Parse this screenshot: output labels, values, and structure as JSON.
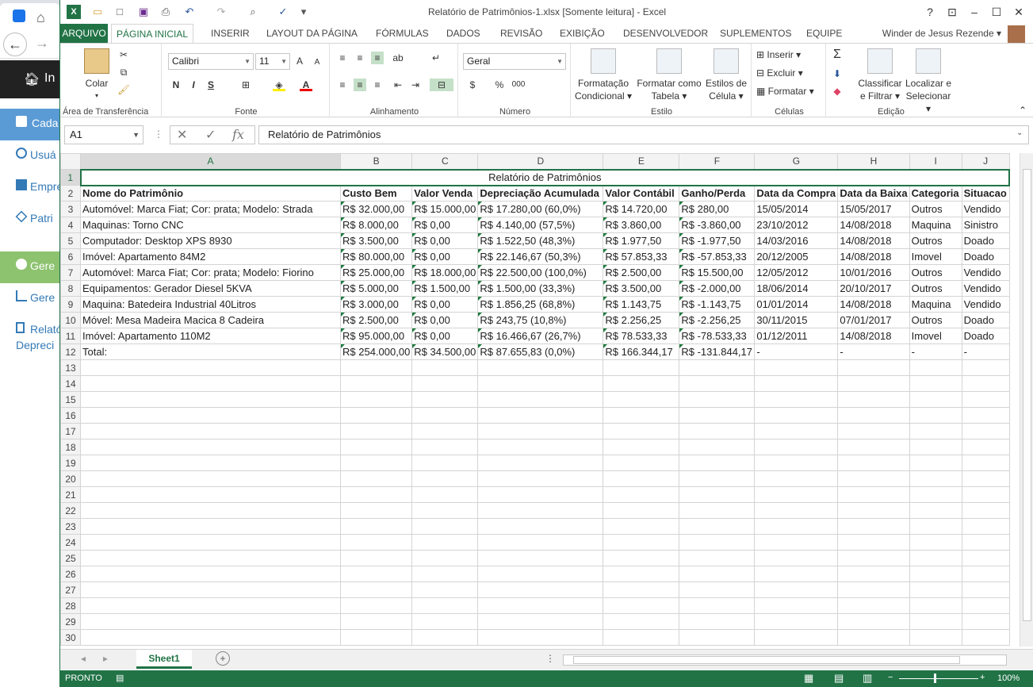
{
  "background_app": {
    "nav_brand": "In",
    "items": [
      {
        "label": "Cada"
      },
      {
        "label": "Usuá"
      },
      {
        "label": "Empre"
      },
      {
        "label": "Patri"
      },
      {
        "label": "Gere"
      },
      {
        "label": "Gere"
      },
      {
        "label": "Relató"
      },
      {
        "label": "Depreci"
      }
    ]
  },
  "window": {
    "title": "Relatório de Patrimônios-1.xlsx  [Somente leitura] - Excel",
    "help": "?",
    "user": "Winder de Jesus Rezende"
  },
  "tabs": [
    "ARQUIVO",
    "PÁGINA INICIAL",
    "INSERIR",
    "LAYOUT DA PÁGINA",
    "FÓRMULAS",
    "DADOS",
    "REVISÃO",
    "EXIBIÇÃO",
    "DESENVOLVEDOR",
    "SUPLEMENTOS",
    "EQUIPE"
  ],
  "ribbon": {
    "clipboard": {
      "paste": "Colar",
      "label": "Área de Transferência"
    },
    "font": {
      "name": "Calibri",
      "size": "11",
      "bold": "N",
      "italic": "I",
      "underline": "S",
      "grow": "A",
      "shrink": "A",
      "color": "A",
      "label": "Fonte"
    },
    "alignment": {
      "label": "Alinhamento"
    },
    "number": {
      "format": "Geral",
      "percent": "%",
      "thousands": "000",
      "label": "Número"
    },
    "styles": {
      "cond1": "Formatação",
      "cond2": "Condicional",
      "table1": "Formatar como",
      "table2": "Tabela",
      "cell1": "Estilos de",
      "cell2": "Célula",
      "label": "Estilo"
    },
    "cells": {
      "insert": "Inserir",
      "delete": "Excluir",
      "format": "Formatar",
      "label": "Células"
    },
    "editing": {
      "sort1": "Classificar",
      "sort2": "e Filtrar",
      "find1": "Localizar e",
      "find2": "Selecionar",
      "label": "Edição"
    }
  },
  "formula_bar": {
    "name_box": "A1",
    "fx": "fx",
    "content": "Relatório de Patrimônios"
  },
  "columns": [
    "A",
    "B",
    "C",
    "D",
    "E",
    "F",
    "G",
    "H",
    "I",
    "J"
  ],
  "sheet": {
    "title": "Relatório de Patrimônios",
    "headers": [
      "Nome do Patrimônio",
      "Custo Bem",
      "Valor Venda",
      "Depreciação Acumulada",
      "Valor Contábil",
      "Ganho/Perda",
      "Data da Compra",
      "Data da Baixa",
      "Categoria",
      "Situacao"
    ],
    "rows": [
      [
        "Automóvel: Marca Fiat; Cor: prata; Modelo: Strada",
        "R$ 32.000,00",
        "R$ 15.000,00",
        "R$ 17.280,00 (60,0%)",
        "R$ 14.720,00",
        "R$ 280,00",
        "15/05/2014",
        "15/05/2017",
        "Outros",
        "Vendido"
      ],
      [
        "Maquinas: Torno CNC",
        "R$ 8.000,00",
        "R$ 0,00",
        "R$ 4.140,00 (57,5%)",
        "R$ 3.860,00",
        "R$ -3.860,00",
        "23/10/2012",
        "14/08/2018",
        "Maquina",
        "Sinistro"
      ],
      [
        "Computador: Desktop XPS 8930",
        "R$ 3.500,00",
        "R$ 0,00",
        "R$ 1.522,50 (48,3%)",
        "R$ 1.977,50",
        "R$ -1.977,50",
        "14/03/2016",
        "14/08/2018",
        "Outros",
        "Doado"
      ],
      [
        "Imóvel: Apartamento 84M2",
        "R$ 80.000,00",
        "R$ 0,00",
        "R$ 22.146,67 (50,3%)",
        "R$ 57.853,33",
        "R$ -57.853,33",
        "20/12/2005",
        "14/08/2018",
        "Imovel",
        "Doado"
      ],
      [
        "Automóvel: Marca Fiat; Cor: prata; Modelo: Fiorino",
        "R$ 25.000,00",
        "R$ 18.000,00",
        "R$ 22.500,00 (100,0%)",
        "R$ 2.500,00",
        "R$ 15.500,00",
        "12/05/2012",
        "10/01/2016",
        "Outros",
        "Vendido"
      ],
      [
        "Equipamentos: Gerador Diesel 5KVA",
        "R$ 5.000,00",
        "R$ 1.500,00",
        "R$ 1.500,00 (33,3%)",
        "R$ 3.500,00",
        "R$ -2.000,00",
        "18/06/2014",
        "20/10/2017",
        "Outros",
        "Vendido"
      ],
      [
        "Maquina: Batedeira Industrial 40Litros",
        "R$ 3.000,00",
        "R$ 0,00",
        "R$ 1.856,25 (68,8%)",
        "R$ 1.143,75",
        "R$ -1.143,75",
        "01/01/2014",
        "14/08/2018",
        "Maquina",
        "Vendido"
      ],
      [
        "Móvel: Mesa Madeira Macica 8 Cadeira",
        "R$ 2.500,00",
        "R$ 0,00",
        "R$ 243,75 (10,8%)",
        "R$ 2.256,25",
        "R$ -2.256,25",
        "30/11/2015",
        "07/01/2017",
        "Outros",
        "Doado"
      ],
      [
        "Imóvel: Apartamento 110M2",
        "R$ 95.000,00",
        "R$ 0,00",
        "R$ 16.466,67 (26,7%)",
        "R$ 78.533,33",
        "R$ -78.533,33",
        "01/12/2011",
        "14/08/2018",
        "Imovel",
        "Doado"
      ],
      [
        "Total:",
        "R$ 254.000,00",
        "R$ 34.500,00",
        "R$ 87.655,83 (0,0%)",
        "R$ 166.344,17",
        "R$ -131.844,17",
        "-",
        "-",
        "-",
        "-"
      ]
    ],
    "row_numbers": [
      "1",
      "2",
      "3",
      "4",
      "5",
      "6",
      "7",
      "8",
      "9",
      "10",
      "11",
      "12",
      "13",
      "14",
      "15",
      "16",
      "17",
      "18",
      "19",
      "20",
      "21",
      "22",
      "23",
      "24",
      "25",
      "26",
      "27",
      "28",
      "29",
      "30"
    ]
  },
  "sheet_tabs": {
    "active": "Sheet1",
    "add": "+"
  },
  "status": {
    "mode": "PRONTO",
    "zoom": "100%"
  },
  "colors": {
    "excel_green": "#217346",
    "header_bg": "#f3f3f3",
    "gridline": "#d4d4d4"
  }
}
